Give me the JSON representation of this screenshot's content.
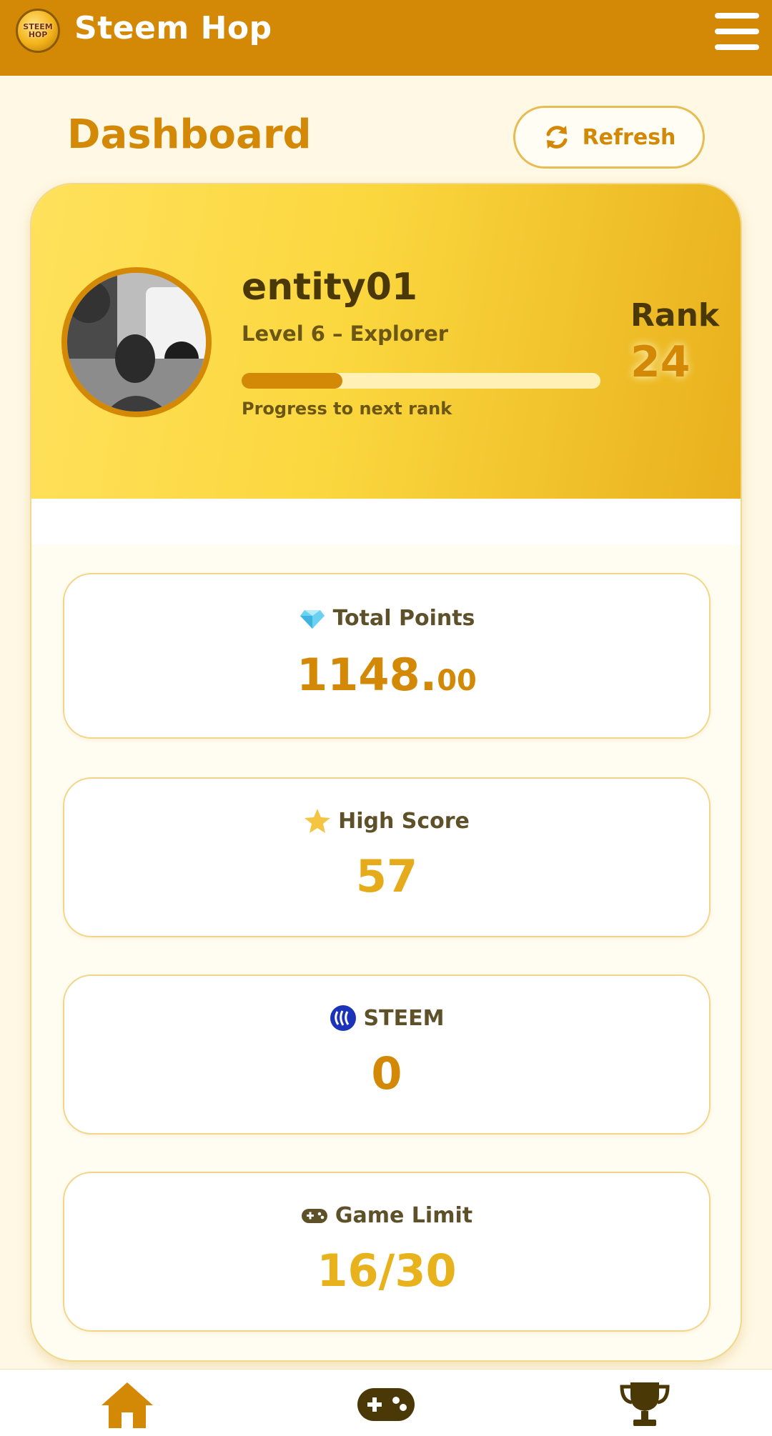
{
  "header": {
    "logo_line1": "STEEM",
    "logo_line2": "HOP",
    "app_title": "Steem Hop",
    "menu_icon": "hamburger-menu-icon"
  },
  "page": {
    "title": "Dashboard",
    "refresh_label": "Refresh",
    "refresh_icon": "refresh-icon"
  },
  "profile": {
    "username": "entity01",
    "level": "Level 6 – Explorer",
    "progress_fraction": 0.28,
    "progress_label": "Progress to next rank",
    "rank_label": "Rank",
    "rank_value": "24"
  },
  "stats": {
    "total_points": {
      "label": "Total Points",
      "value_main": "1148.",
      "value_decimals": "00",
      "icon": "diamond-icon",
      "color": "#d38806"
    },
    "high_score": {
      "label": "High Score",
      "value": "57",
      "icon": "star-icon",
      "color": "#e5ab1a"
    },
    "steem": {
      "label": "STEEM",
      "value": "0",
      "icon": "steem-logo-icon",
      "color": "#d38806"
    },
    "game_limit": {
      "label": "Game Limit",
      "value": "16/30",
      "icon": "gamepad-icon",
      "color": "#e8b21c"
    }
  },
  "nav": {
    "items": [
      {
        "name": "home",
        "icon": "home-icon",
        "color": "#d38806"
      },
      {
        "name": "games",
        "icon": "gamepad-icon",
        "color": "#4a3807"
      },
      {
        "name": "leaderboard",
        "icon": "trophy-icon",
        "color": "#4a3807"
      }
    ]
  },
  "colors": {
    "accent": "#d38806",
    "header_bg": "#d38806",
    "page_bg": "#fff8e5",
    "card_gradient_start": "#ffe15c",
    "card_gradient_end": "#e8b01c"
  }
}
